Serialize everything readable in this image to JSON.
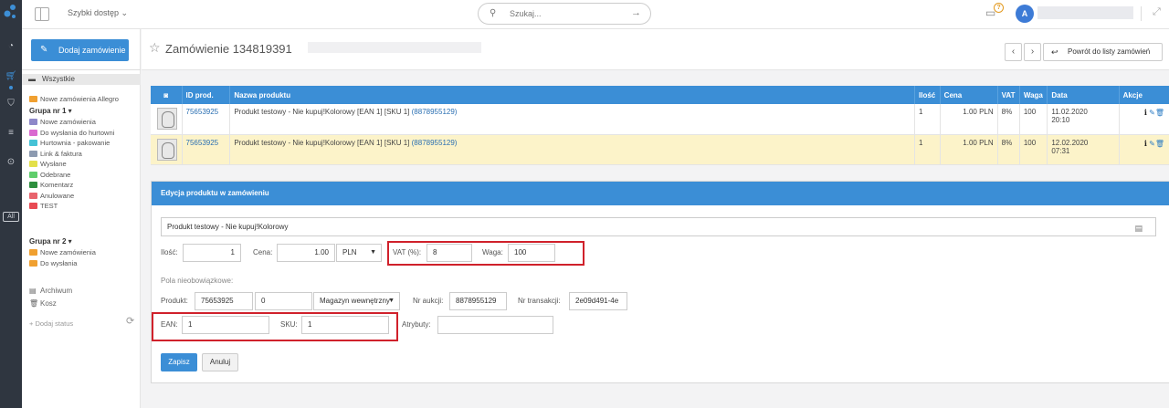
{
  "topbar": {
    "quick_access": "Szybki dostęp",
    "search_placeholder": "Szukaj...",
    "notification_badge": "?",
    "avatar_initial": "A"
  },
  "leftpanel": {
    "add_order": "Dodaj zamówienie",
    "all_label": "Wszystkie",
    "new_allegro": "Nowe zamówienia Allegro",
    "group1": {
      "title": "Grupa nr 1 ▾",
      "items": [
        {
          "label": "Nowe zamówienia",
          "color": "#8e88c9"
        },
        {
          "label": "Do wysłania do hurtowni",
          "color": "#d96ad0"
        },
        {
          "label": "Hurtownia - pakowanie",
          "color": "#45c2d6"
        },
        {
          "label": "Link & faktura",
          "color": "#8c9ab0"
        },
        {
          "label": "Wysłane",
          "color": "#e3e04a"
        },
        {
          "label": "Odebrane",
          "color": "#5fce6c"
        },
        {
          "label": "Komentarz",
          "color": "#2e8f3e"
        },
        {
          "label": "Anulowane",
          "color": "#e8646d"
        },
        {
          "label": "TEST",
          "color": "#e84a53"
        }
      ]
    },
    "group2": {
      "title": "Grupa nr 2 ▾",
      "items": [
        {
          "label": "Nowe zamówienia",
          "color": "#f0a030"
        },
        {
          "label": "Do wysłania",
          "color": "#f0a030"
        }
      ]
    },
    "allegro_color": "#f0a030",
    "archive": "Archiwum",
    "trash": "Kosz",
    "add_status": "+ Dodaj status"
  },
  "header": {
    "title": "Zamówienie 134819391",
    "back_label": "Powrót do listy zamówień"
  },
  "table": {
    "columns": [
      "",
      "ID prod.",
      "Nazwa produktu",
      "Ilość",
      "Cena",
      "VAT",
      "Waga",
      "Data",
      "Akcje"
    ],
    "rows": [
      {
        "id": "75653925",
        "name": "Produkt testowy - Nie kupuj!Kolorowy [EAN 1] [SKU 1] ",
        "link": "(8878955129)",
        "qty": "1",
        "price": "1.00 PLN",
        "vat": "8%",
        "weight": "100",
        "date1": "11.02.2020",
        "date2": "20:10"
      },
      {
        "id": "75653925",
        "name": "Produkt testowy - Nie kupuj!Kolorowy [EAN 1] [SKU 1] ",
        "link": "(8878955129)",
        "qty": "1",
        "price": "1.00 PLN",
        "vat": "8%",
        "weight": "100",
        "date1": "12.02.2020",
        "date2": "07:31"
      }
    ]
  },
  "edit": {
    "title": "Edycja produktu w zamówieniu",
    "product_name": "Produkt testowy - Nie kupuj!Kolorowy",
    "qty_label": "Ilość:",
    "qty_value": "1",
    "price_label": "Cena:",
    "price_value": "1.00",
    "currency": "PLN",
    "vat_label": "VAT (%):",
    "vat_value": "8",
    "weight_label": "Waga:",
    "weight_value": "100",
    "optional_label": "Pola nieobowiązkowe:",
    "product_label": "Produkt:",
    "product_id": "75653925",
    "product_variant": "0",
    "warehouse": "Magazyn wewnętrzny",
    "auction_label": "Nr aukcji:",
    "auction_value": "8878955129",
    "transaction_label": "Nr transakcji:",
    "transaction_value": "2e09d491-4e",
    "ean_label": "EAN:",
    "ean_value": "1",
    "sku_label": "SKU:",
    "sku_value": "1",
    "attributes_label": "Atrybuty:",
    "attributes_value": "",
    "save": "Zapisz",
    "cancel": "Anuluj"
  }
}
